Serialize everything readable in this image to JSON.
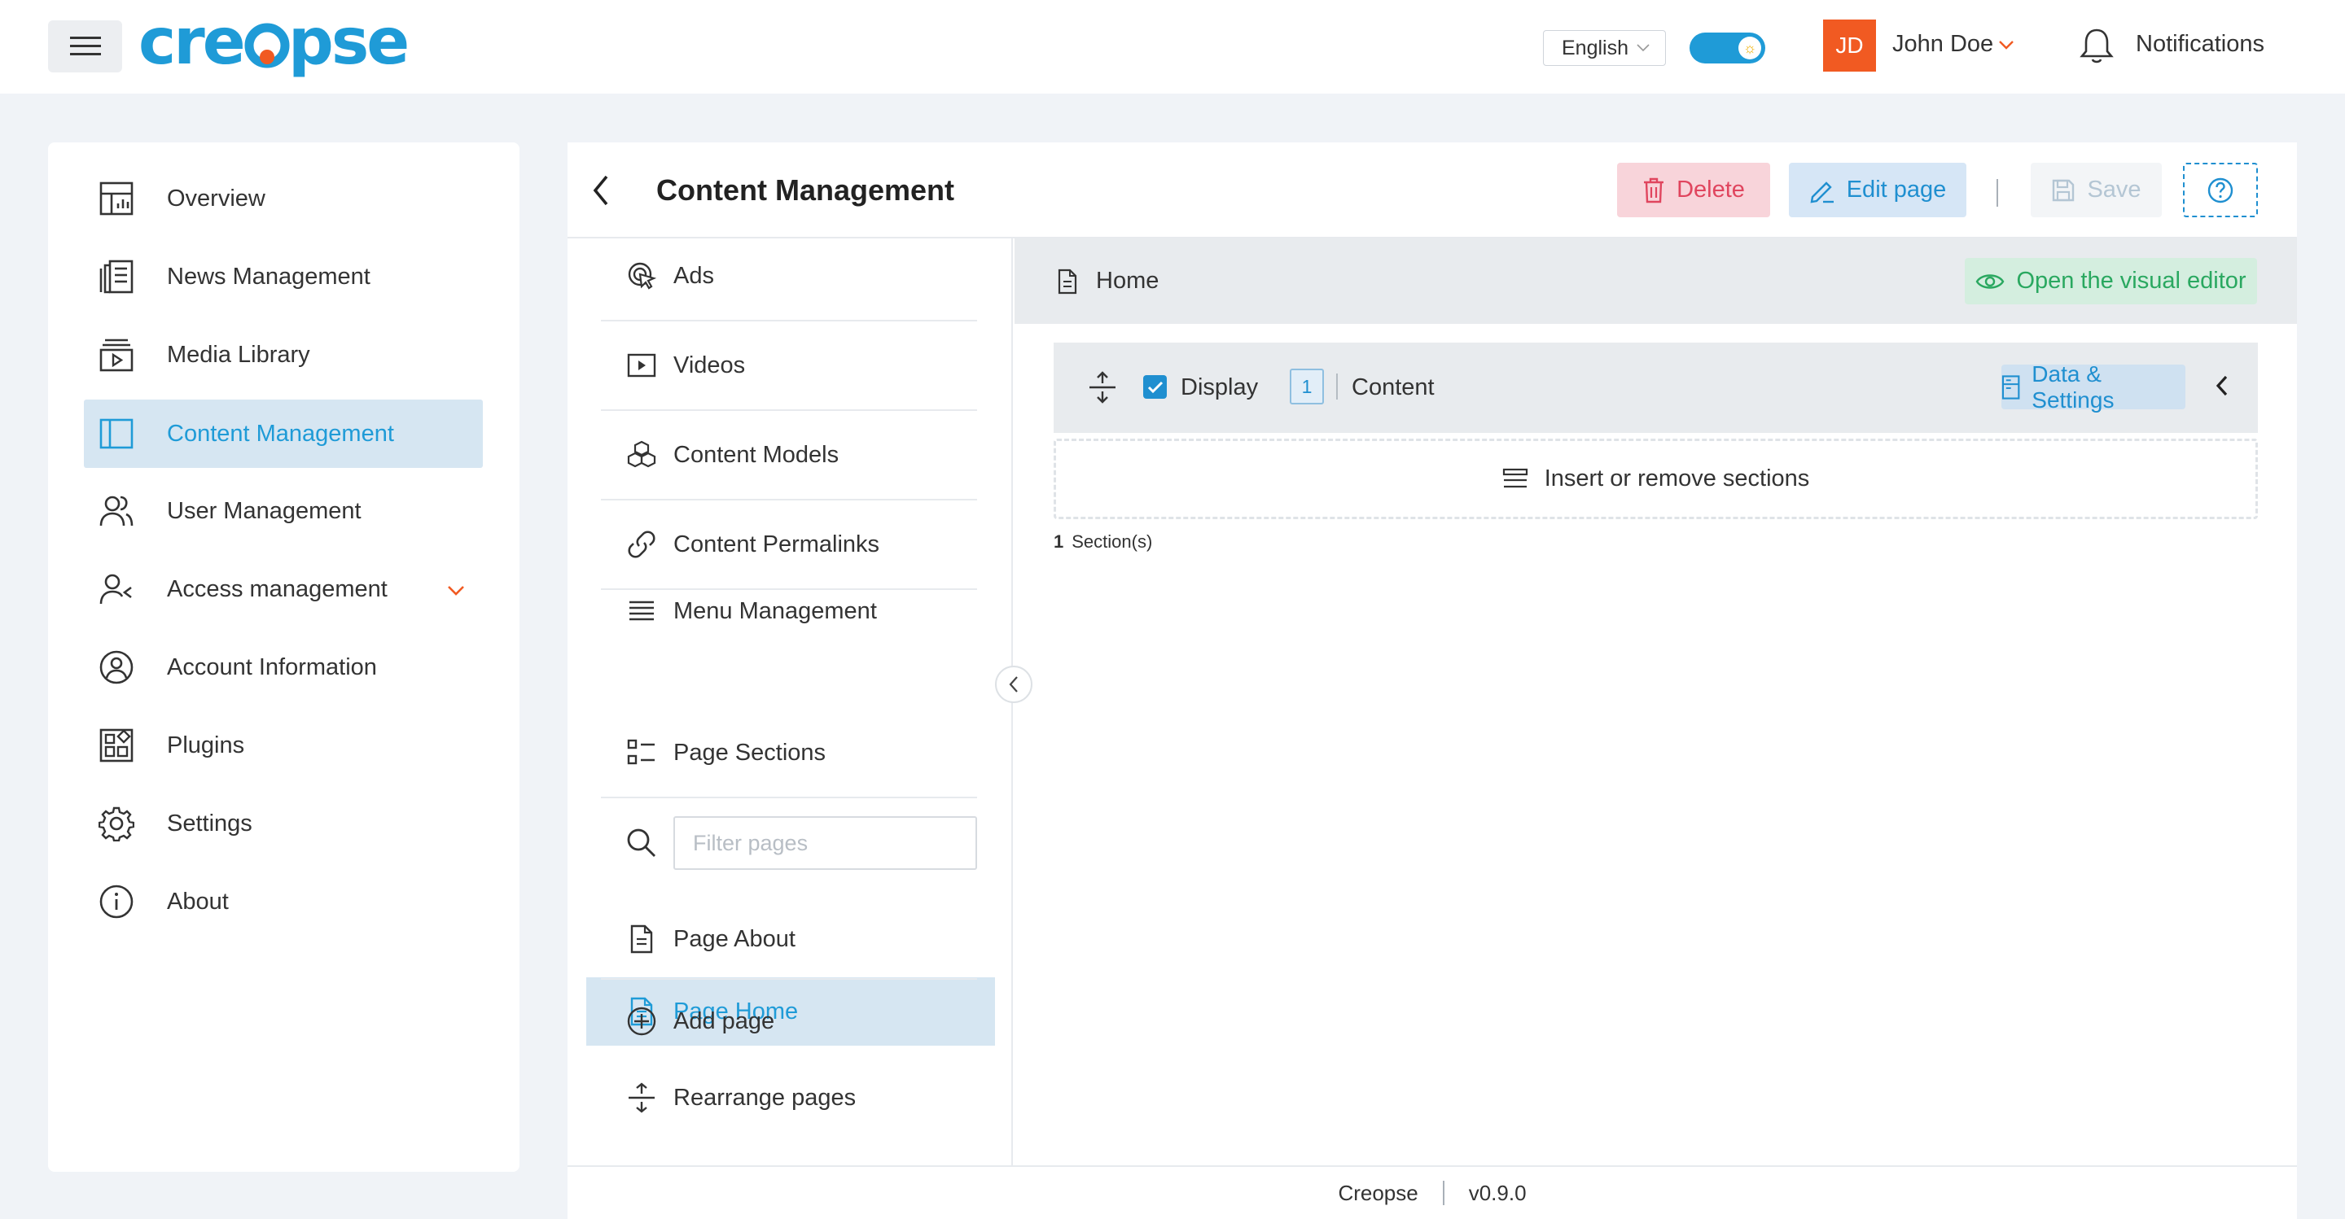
{
  "app": {
    "logo_text": "creopse",
    "language": "English",
    "user_initials": "JD",
    "user_name": "John Doe",
    "notifications_label": "Notifications",
    "accent": "#1f9bd7",
    "brand_orange": "#f15a22"
  },
  "sidebar": {
    "items": [
      {
        "label": "Overview",
        "icon": "overview-icon"
      },
      {
        "label": "News Management",
        "icon": "news-icon"
      },
      {
        "label": "Media Library",
        "icon": "media-library-icon"
      },
      {
        "label": "Content Management",
        "icon": "content-management-icon",
        "active": true
      },
      {
        "label": "User Management",
        "icon": "users-icon"
      },
      {
        "label": "Access management",
        "icon": "access-icon",
        "has_dropdown": true
      },
      {
        "label": "Account Information",
        "icon": "account-icon"
      },
      {
        "label": "Plugins",
        "icon": "plugins-icon"
      },
      {
        "label": "Settings",
        "icon": "gear-icon"
      },
      {
        "label": "About",
        "icon": "info-icon"
      }
    ]
  },
  "header": {
    "title": "Content Management",
    "delete_label": "Delete",
    "edit_label": "Edit page",
    "save_label": "Save"
  },
  "subnav": {
    "items": [
      {
        "label": "Ads",
        "icon": "ads-icon"
      },
      {
        "label": "Videos",
        "icon": "video-icon"
      },
      {
        "label": "Content Models",
        "icon": "content-models-icon"
      },
      {
        "label": "Content Permalinks",
        "icon": "link-icon"
      },
      {
        "label": "Menu Management",
        "icon": "menu-icon"
      },
      {
        "label": "Page Sections",
        "icon": "page-sections-icon"
      }
    ],
    "filter_placeholder": "Filter pages",
    "pages": [
      {
        "label": "Page Home",
        "active": true
      },
      {
        "label": "Page About"
      }
    ],
    "add_page": "Add page",
    "rearrange_pages": "Rearrange pages"
  },
  "content": {
    "page_name": "Home",
    "visual_editor_label": "Open the visual editor",
    "section": {
      "display_label": "Display",
      "index": "1",
      "name": "Content",
      "data_settings_label": "Data & Settings"
    },
    "insert_label": "Insert or remove sections",
    "section_count": "1",
    "section_count_label": "Section(s)"
  },
  "footer": {
    "name": "Creopse",
    "version": "v0.9.0"
  }
}
